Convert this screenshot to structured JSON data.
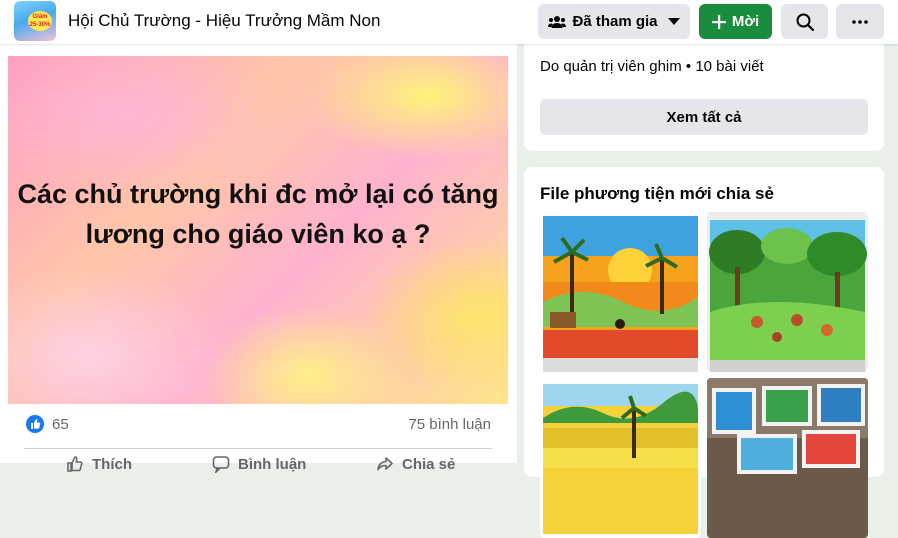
{
  "header": {
    "group_title": "Hội Chủ Trường - Hiệu Trưởng Mầm Non",
    "thumb_badge_line1": "Giảm",
    "thumb_badge_line2": "25-30%",
    "joined_label": "Đã tham gia",
    "invite_label": "Mời"
  },
  "post": {
    "text": "Các chủ trường khi đc mở lại có tăng lương cho giáo viên ko ạ ?",
    "like_count": "65",
    "comment_count": "75 bình luận",
    "actions": [
      "Thích",
      "Bình luận",
      "Chia sẻ"
    ]
  },
  "pinned": {
    "subtitle": "Do quản trị viên ghim • 10 bài viết",
    "see_all_label": "Xem tất cả"
  },
  "media": {
    "title": "File phương tiện mới chia sẻ",
    "tiles": [
      "sunset-landscape-painting",
      "forest-scene-painting",
      "rice-field-painting",
      "framed-paintings-display"
    ]
  },
  "colors": {
    "accent_green": "#1a8c3d",
    "like_blue": "#1877f2",
    "secondary_button": "#e4e6eb",
    "page_background": "#e9efe9"
  }
}
